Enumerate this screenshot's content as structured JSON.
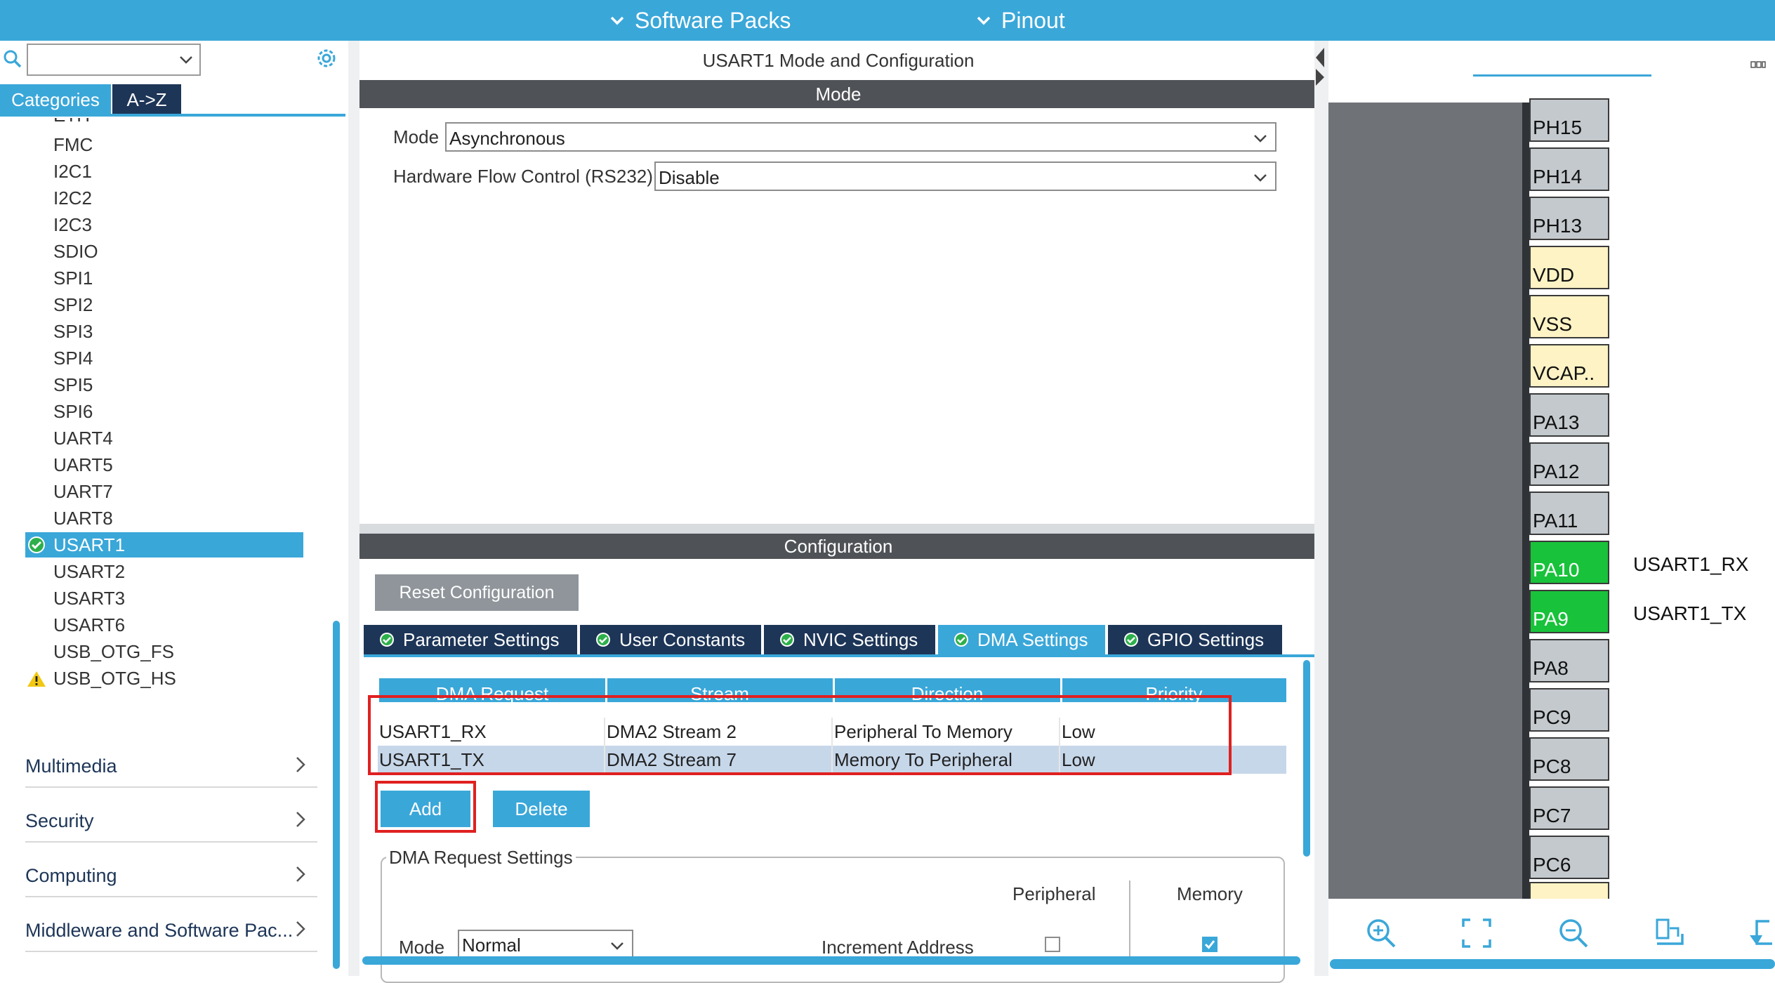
{
  "topbar": {
    "software_packs": "Software Packs",
    "pinout": "Pinout"
  },
  "left": {
    "tabs": {
      "categories": "Categories",
      "az": "A->Z"
    },
    "peripherals": [
      {
        "label": "ETH",
        "status": "none"
      },
      {
        "label": "FMC",
        "status": "none"
      },
      {
        "label": "I2C1",
        "status": "none"
      },
      {
        "label": "I2C2",
        "status": "none"
      },
      {
        "label": "I2C3",
        "status": "none"
      },
      {
        "label": "SDIO",
        "status": "none"
      },
      {
        "label": "SPI1",
        "status": "none"
      },
      {
        "label": "SPI2",
        "status": "none"
      },
      {
        "label": "SPI3",
        "status": "none"
      },
      {
        "label": "SPI4",
        "status": "none"
      },
      {
        "label": "SPI5",
        "status": "none"
      },
      {
        "label": "SPI6",
        "status": "none"
      },
      {
        "label": "UART4",
        "status": "none"
      },
      {
        "label": "UART5",
        "status": "none"
      },
      {
        "label": "UART7",
        "status": "none"
      },
      {
        "label": "UART8",
        "status": "none"
      },
      {
        "label": "USART1",
        "status": "ok",
        "selected": true
      },
      {
        "label": "USART2",
        "status": "none"
      },
      {
        "label": "USART3",
        "status": "none"
      },
      {
        "label": "USART6",
        "status": "none"
      },
      {
        "label": "USB_OTG_FS",
        "status": "none"
      },
      {
        "label": "USB_OTG_HS",
        "status": "warning"
      }
    ],
    "groups": [
      "Multimedia",
      "Security",
      "Computing",
      "Middleware and Software Pac..."
    ]
  },
  "mid": {
    "title": "USART1 Mode and Configuration",
    "mode_header": "Mode",
    "mode_label": "Mode",
    "mode_value": "Asynchronous",
    "flow_label": "Hardware Flow Control (RS232)",
    "flow_value": "Disable",
    "config_header": "Configuration",
    "reset_button": "Reset Configuration",
    "tabs": [
      "Parameter Settings",
      "User Constants",
      "NVIC Settings",
      "DMA Settings",
      "GPIO Settings"
    ],
    "active_tab": "DMA Settings",
    "dma_columns": [
      "DMA Request",
      "Stream",
      "Direction",
      "Priority"
    ],
    "dma_rows": [
      {
        "request": "USART1_RX",
        "stream": "DMA2 Stream 2",
        "direction": "Peripheral To Memory",
        "priority": "Low"
      },
      {
        "request": "USART1_TX",
        "stream": "DMA2 Stream 7",
        "direction": "Memory To Peripheral",
        "priority": "Low"
      }
    ],
    "add_button": "Add",
    "delete_button": "Delete",
    "dma_settings": {
      "legend": "DMA Request Settings",
      "peripheral_label": "Peripheral",
      "memory_label": "Memory",
      "mode_label": "Mode",
      "mode_value": "Normal",
      "increment_label": "Increment Address",
      "peripheral_increment": false,
      "memory_increment": true
    }
  },
  "chip": {
    "pins": [
      {
        "name": "PH15",
        "type": "io"
      },
      {
        "name": "PH14",
        "type": "io"
      },
      {
        "name": "PH13",
        "type": "io"
      },
      {
        "name": "VDD",
        "type": "power"
      },
      {
        "name": "VSS",
        "type": "power"
      },
      {
        "name": "VCAP..",
        "type": "power"
      },
      {
        "name": "PA13",
        "type": "io"
      },
      {
        "name": "PA12",
        "type": "io"
      },
      {
        "name": "PA11",
        "type": "io"
      },
      {
        "name": "PA10",
        "type": "active",
        "signal": "USART1_RX"
      },
      {
        "name": "PA9",
        "type": "active",
        "signal": "USART1_TX"
      },
      {
        "name": "PA8",
        "type": "io"
      },
      {
        "name": "PC9",
        "type": "io"
      },
      {
        "name": "PC8",
        "type": "io"
      },
      {
        "name": "PC7",
        "type": "io"
      },
      {
        "name": "PC6",
        "type": "io"
      }
    ]
  },
  "colors": {
    "accent": "#3aa7d9",
    "navy": "#1d3557",
    "header_dark": "#4f5256",
    "pin_active": "#18c23a",
    "pin_power": "#fdf3c4",
    "highlight_red": "#e02020"
  },
  "icons": [
    "chevron-down-icon",
    "search-icon",
    "gear-icon",
    "check-circle-icon",
    "warning-icon",
    "chevron-right-icon",
    "zoom-in-icon",
    "fit-screen-icon",
    "zoom-out-icon",
    "export-icon",
    "rotate-icon",
    "collapse-icon"
  ]
}
